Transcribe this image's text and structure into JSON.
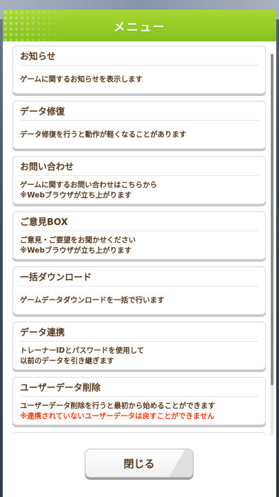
{
  "modal": {
    "title": "メニュー"
  },
  "menu": [
    {
      "title": "お知らせ",
      "lines": [
        "ゲームに関するお知らせを表示します"
      ]
    },
    {
      "title": "データ修復",
      "lines": [
        "データ修復を行うと動作が軽くなることがあります"
      ]
    },
    {
      "title": "お問い合わせ",
      "lines": [
        "ゲームに関するお問い合わせはこちらから",
        "※Webブラウザが立ち上がります"
      ]
    },
    {
      "title": "ご意見BOX",
      "lines": [
        "ご意見・ご要望をお聞かせください",
        "※Webブラウザが立ち上がります"
      ]
    },
    {
      "title": "一括ダウンロード",
      "lines": [
        "ゲームデータダウンロードを一括で行います"
      ]
    },
    {
      "title": "データ連携",
      "lines": [
        "トレーナーIDとパスワードを使用して",
        "以前のデータを引き継ぎます"
      ]
    },
    {
      "title": "ユーザーデータ削除",
      "lines": [
        "ユーザーデータ削除を行うと最初から始めることができます"
      ],
      "warning": "※連携されていないユーザーデータは戻すことができません"
    }
  ],
  "footer": {
    "close_label": "閉じる"
  },
  "colors": {
    "header": "#8cc63f",
    "text": "#5a3a1e",
    "warning": "#ff3b12"
  }
}
